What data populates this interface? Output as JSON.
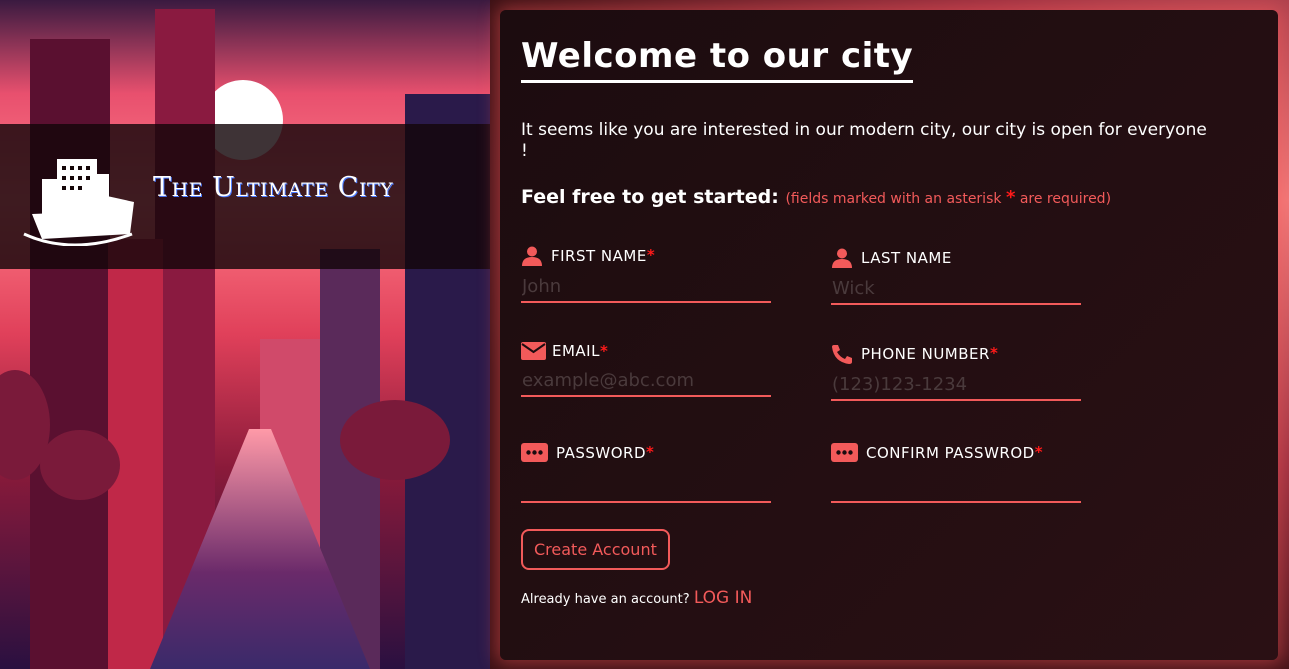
{
  "brand": {
    "title": "The Ultimate City"
  },
  "form": {
    "title": "Welcome to our city",
    "intro": "It seems like you are interested in our modern city, our city is open for everyone !",
    "started": "Feel free to get started:",
    "note_before": "(fields marked with an asterisk",
    "note_star": "*",
    "note_after": "are required)",
    "required_mark": "*",
    "fields": [
      {
        "label": "FIRST NAME",
        "placeholder": "John",
        "required": true,
        "icon": "user-icon"
      },
      {
        "label": "LAST NAME",
        "placeholder": "Wick",
        "required": false,
        "icon": "user-icon"
      },
      {
        "label": "EMAIL",
        "placeholder": "example@abc.com",
        "required": true,
        "icon": "envelope-icon"
      },
      {
        "label": "PHONE NUMBER",
        "placeholder": "(123)123-1234",
        "required": true,
        "icon": "phone-icon"
      },
      {
        "label": "PASSWORD",
        "placeholder": "",
        "required": true,
        "icon": "password-icon"
      },
      {
        "label": "CONFIRM PASSWROD",
        "placeholder": "",
        "required": true,
        "icon": "password-icon"
      }
    ],
    "submit_label": "Create Account",
    "login_prompt": "Already have an account?",
    "login_link": "LOG IN"
  },
  "colors": {
    "accent": "#f25a5a",
    "required": "#ff1a1a"
  }
}
